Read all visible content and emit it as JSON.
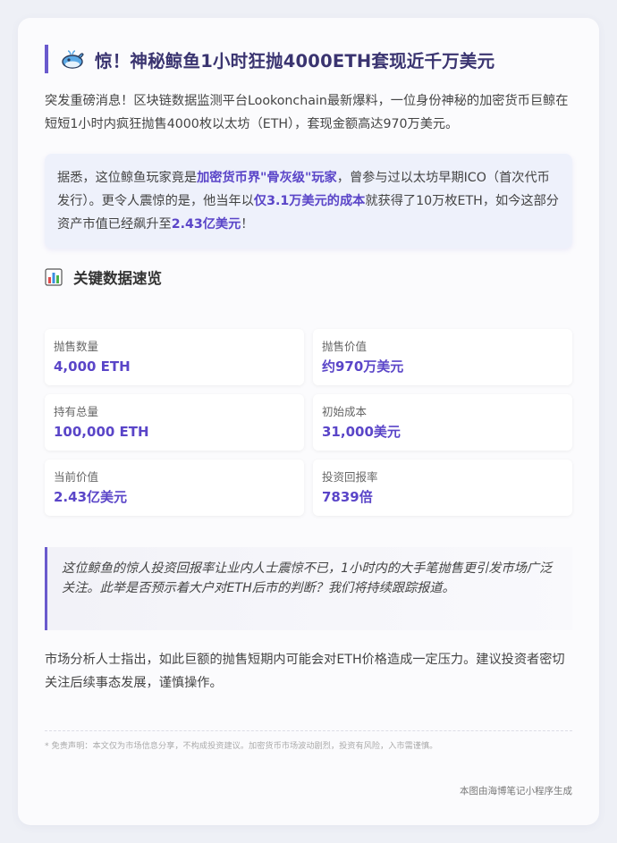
{
  "title": "惊！神秘鲸鱼1小时狂抛4000ETH套现近千万美元",
  "intro": "突发重磅消息！区块链数据监测平台Lookonchain最新爆料，一位身份神秘的加密货币巨鲸在短短1小时内疯狂抛售4000枚以太坊（ETH），套现金额高达970万美元。",
  "highlight": {
    "part1": "据悉，这位鲸鱼玩家竟是",
    "em1": "加密货币界\"骨灰级\"玩家",
    "part2": "，曾参与过以太坊早期ICO（首次代币发行）。更令人震惊的是，他当年以",
    "em2": "仅3.1万美元的成本",
    "part3": "就获得了10万枚ETH，如今这部分资产市值已经飙升至",
    "em3": "2.43亿美元",
    "part4": "！"
  },
  "section_title": "关键数据速览",
  "stats": [
    {
      "label": "抛售数量",
      "value": "4,000 ETH"
    },
    {
      "label": "抛售价值",
      "value": "约970万美元"
    },
    {
      "label": "持有总量",
      "value": "100,000 ETH"
    },
    {
      "label": "初始成本",
      "value": "31,000美元"
    },
    {
      "label": "当前价值",
      "value": "2.43亿美元"
    },
    {
      "label": "投资回报率",
      "value": "7839倍"
    }
  ],
  "quote": "这位鲸鱼的惊人投资回报率让业内人士震惊不已，1小时内的大手笔抛售更引发市场广泛关注。此举是否预示着大户对ETH后市的判断？我们将持续跟踪报道。",
  "analysis": "市场分析人士指出，如此巨额的抛售短期内可能会对ETH价格造成一定压力。建议投资者密切关注后续事态发展，谨慎操作。",
  "disclaimer": "* 免责声明：本文仅为市场信息分享，不构成投资建议。加密货币市场波动剧烈，投资有风险，入市需谨慎。",
  "footer": "本图由海博笔记小程序生成",
  "icons": {
    "title": "whale-icon",
    "section": "bar-chart-icon"
  },
  "colors": {
    "accent": "#6a5acd",
    "highlight_text": "#5a45c8"
  }
}
